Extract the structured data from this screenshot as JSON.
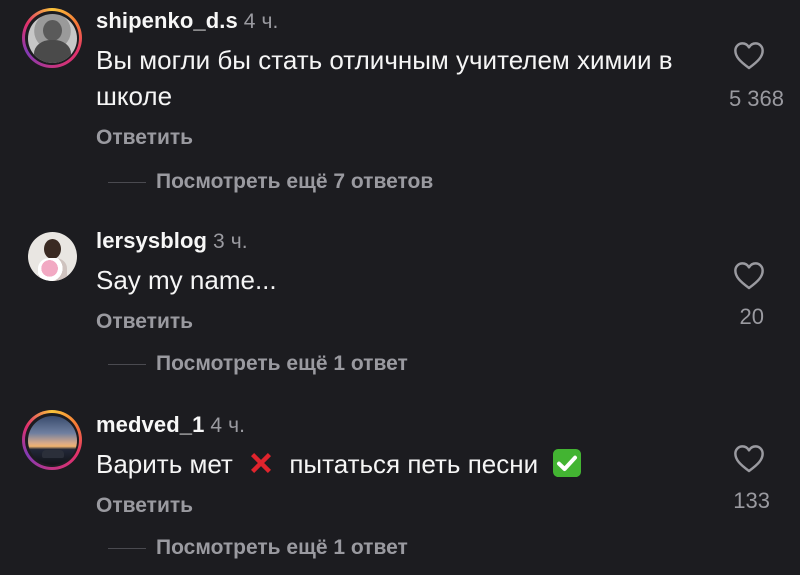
{
  "comments": [
    {
      "username": "shipenko_d.s",
      "time": "4 ч.",
      "text": "Вы могли бы стать отличным учителем химии в школе",
      "likes": "5 368",
      "reply_label": "Ответить",
      "more_replies": "Посмотреть ещё 7 ответов",
      "avatar_ring": "story"
    },
    {
      "username": "lersysblog",
      "time": "3 ч.",
      "text": "Say my name...",
      "likes": "20",
      "reply_label": "Ответить",
      "more_replies": "Посмотреть ещё 1 ответ",
      "avatar_ring": "none"
    },
    {
      "username": "medved_1",
      "time": "4 ч.",
      "text_part1": "Варить мет",
      "text_part2": "пытаться петь песни",
      "likes": "133",
      "reply_label": "Ответить",
      "more_replies": "Посмотреть ещё 1 ответ",
      "avatar_ring": "story"
    }
  ],
  "icons": {
    "like": "heart-outline-icon",
    "cross_emoji": "red-cross-emoji",
    "check_emoji": "green-check-emoji"
  },
  "colors": {
    "background": "#1c1c20",
    "text_primary": "#f5f5f5",
    "text_secondary": "#9a9aa0",
    "cross": "#e0242d",
    "check": "#43b432"
  }
}
